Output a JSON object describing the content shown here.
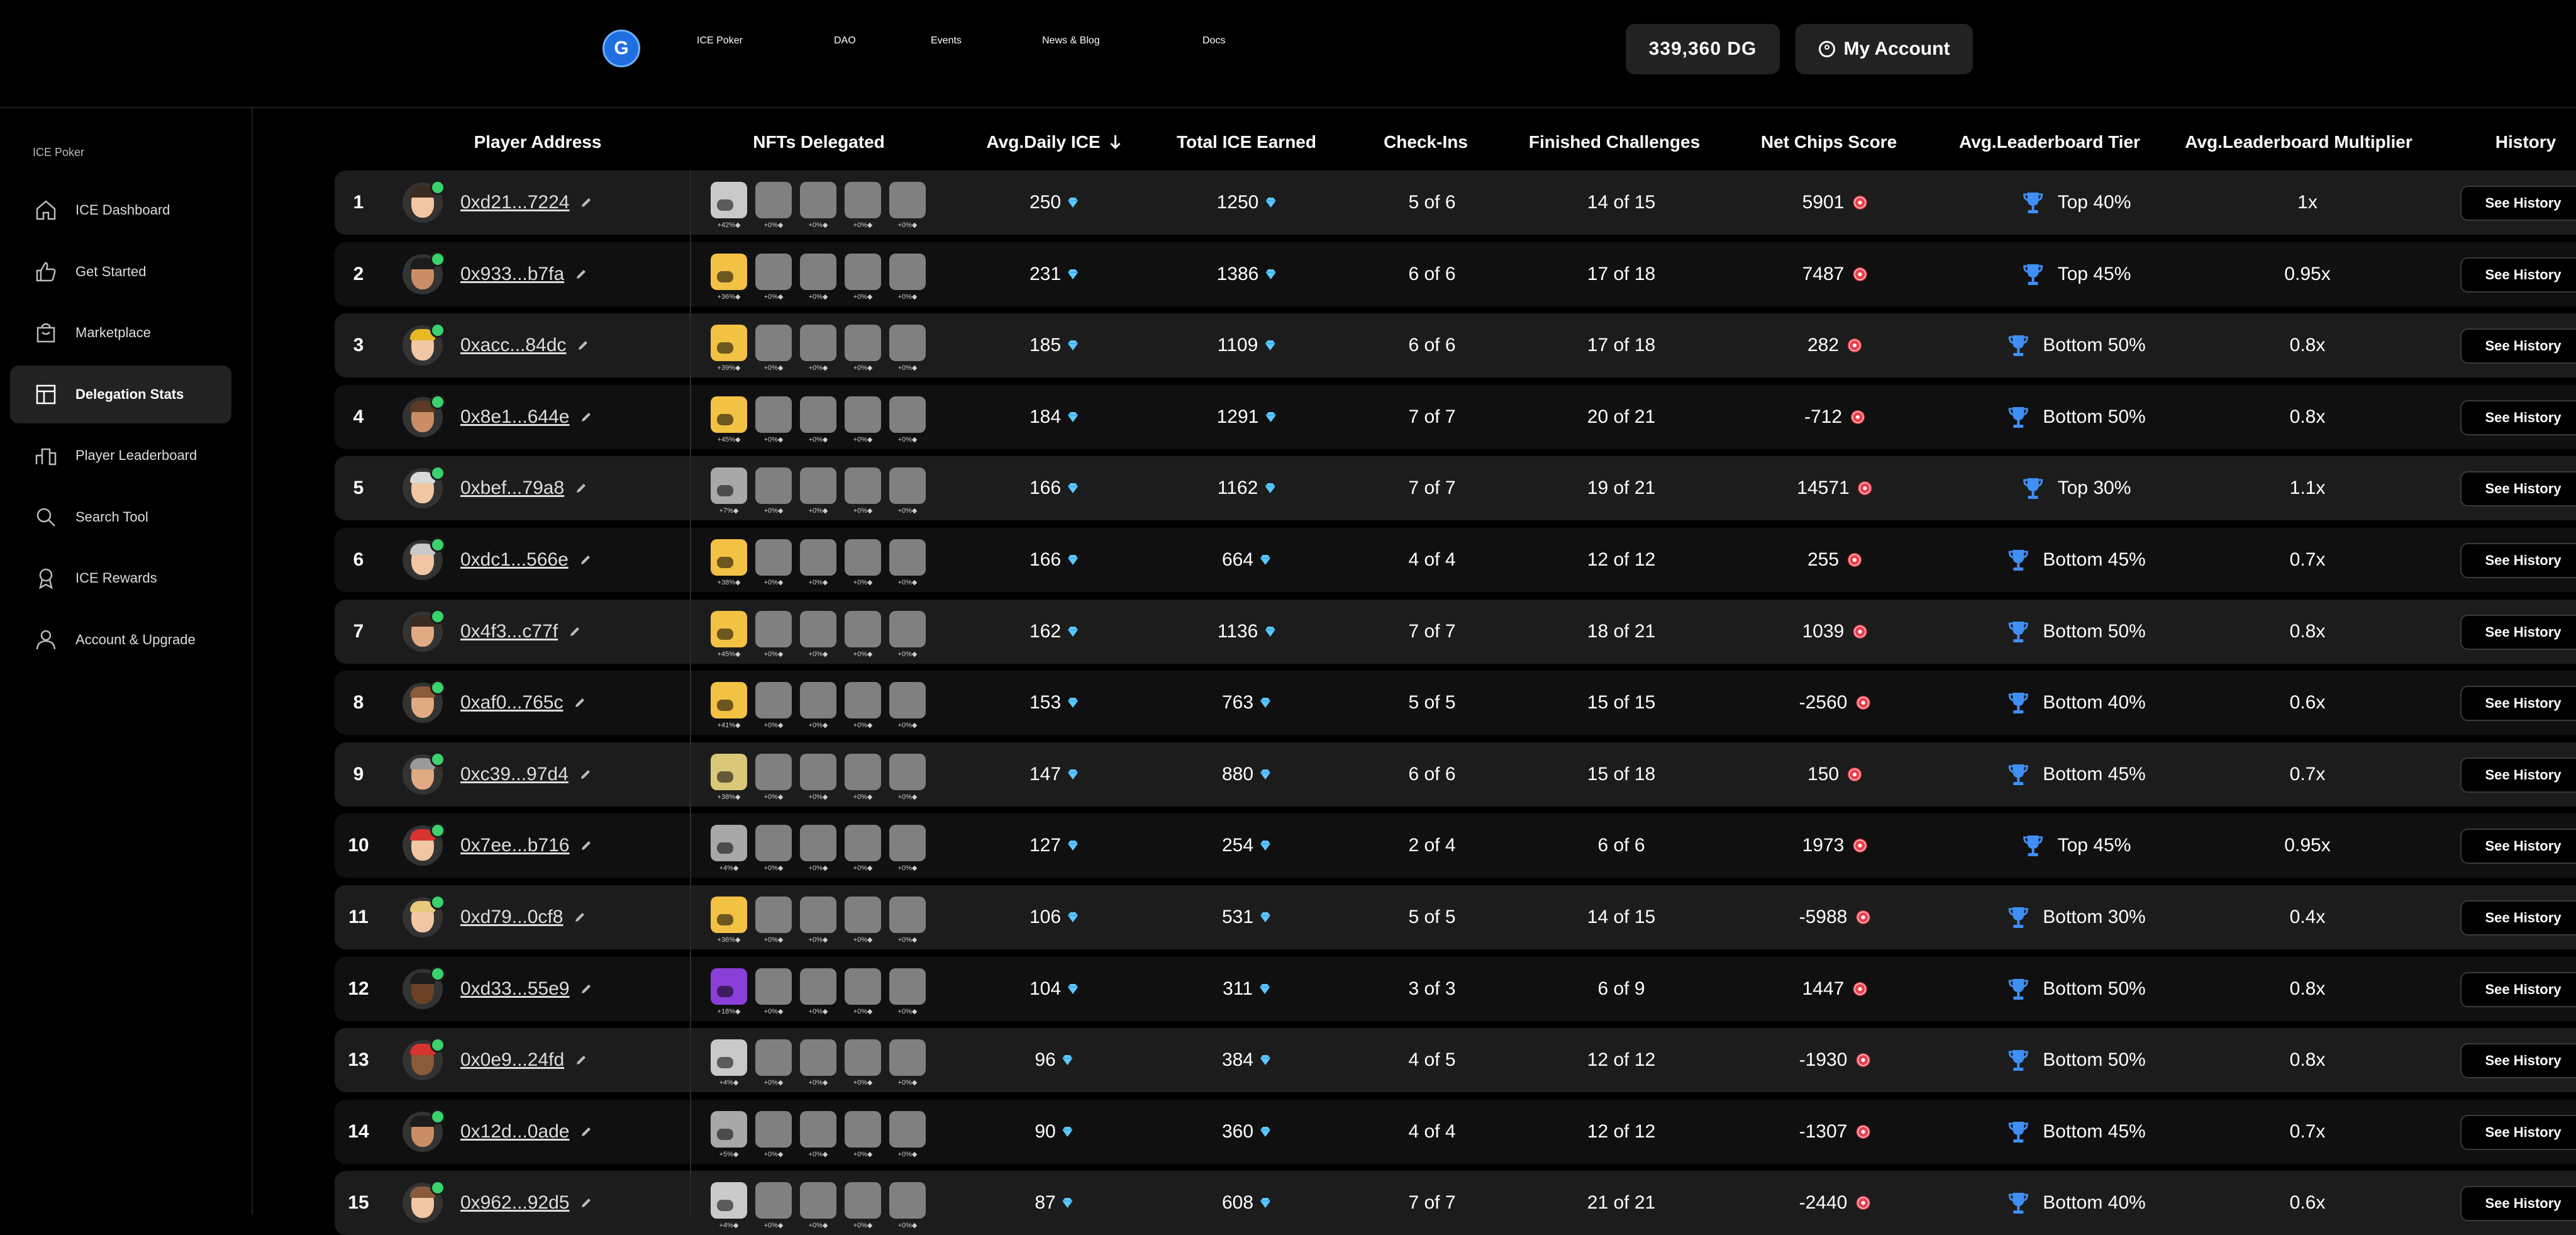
{
  "header": {
    "nav": [
      "ICE Poker",
      "DAO",
      "Events",
      "News & Blog",
      "Docs"
    ],
    "balance": "339,360 DG",
    "account_label": "My Account"
  },
  "sidebar": {
    "title": "ICE Poker",
    "items": [
      {
        "label": "ICE Dashboard",
        "icon": "home-icon"
      },
      {
        "label": "Get Started",
        "icon": "thumbs-up-icon"
      },
      {
        "label": "Marketplace",
        "icon": "shopping-bag-icon"
      },
      {
        "label": "Delegation Stats",
        "icon": "table-icon",
        "active": true
      },
      {
        "label": "Player Leaderboard",
        "icon": "leaderboard-icon"
      },
      {
        "label": "Search Tool",
        "icon": "search-icon"
      },
      {
        "label": "ICE Rewards",
        "icon": "award-icon"
      },
      {
        "label": "Account & Upgrade",
        "icon": "user-icon"
      }
    ]
  },
  "table": {
    "headers": {
      "player": "Player Address",
      "nfts": "NFTs Delegated",
      "avg_ice": "Avg.Daily ICE",
      "total_ice": "Total ICE Earned",
      "checkins": "Check-Ins",
      "challenges": "Finished Challenges",
      "chips": "Net Chips Score",
      "tier": "Avg.Leaderboard Tier",
      "multiplier": "Avg.Leaderboard Multiplier",
      "history": "History"
    },
    "history_label": "See History",
    "empty_nft_pct": "+0%",
    "colors": {
      "gem": "#5cc8ff",
      "chip": "#e8414f",
      "trophy": "#3f8ff5",
      "online": "#3bd16f"
    },
    "rows": [
      {
        "rank": "1",
        "address": "0xd21...7224",
        "nft_pct": "+42%",
        "nft_color": "#c9c9c9",
        "avg_ice": "250",
        "total_ice": "1250",
        "checkins": "5 of 6",
        "challenges": "14 of 15",
        "chips": "5901",
        "tier": "Top 40%",
        "multiplier": "1x",
        "skin": "#f1c7a3",
        "hair": "#3b2a1f"
      },
      {
        "rank": "2",
        "address": "0x933...b7fa",
        "nft_pct": "+36%",
        "nft_color": "#f3c244",
        "avg_ice": "231",
        "total_ice": "1386",
        "checkins": "6 of 6",
        "challenges": "17 of 18",
        "chips": "7487",
        "tier": "Top 45%",
        "multiplier": "0.95x",
        "skin": "#c98e66",
        "hair": "#1c1c1c"
      },
      {
        "rank": "3",
        "address": "0xacc...84dc",
        "nft_pct": "+39%",
        "nft_color": "#f3c244",
        "avg_ice": "185",
        "total_ice": "1109",
        "checkins": "6 of 6",
        "challenges": "17 of 18",
        "chips": "282",
        "tier": "Bottom 50%",
        "multiplier": "0.8x",
        "skin": "#f1c7a3",
        "hair": "#e8b923"
      },
      {
        "rank": "4",
        "address": "0x8e1...644e",
        "nft_pct": "+45%",
        "nft_color": "#f3c244",
        "avg_ice": "184",
        "total_ice": "1291",
        "checkins": "7 of 7",
        "challenges": "20 of 21",
        "chips": "-712",
        "tier": "Bottom 50%",
        "multiplier": "0.8x",
        "skin": "#c98e66",
        "hair": "#5a3a22"
      },
      {
        "rank": "5",
        "address": "0xbef...79a8",
        "nft_pct": "+7%",
        "nft_color": "#a8a8a8",
        "avg_ice": "166",
        "total_ice": "1162",
        "checkins": "7 of 7",
        "challenges": "19 of 21",
        "chips": "14571",
        "tier": "Top 30%",
        "multiplier": "1.1x",
        "skin": "#f1c7a3",
        "hair": "#d9d9d9"
      },
      {
        "rank": "6",
        "address": "0xdc1...566e",
        "nft_pct": "+38%",
        "nft_color": "#f3c244",
        "avg_ice": "166",
        "total_ice": "664",
        "checkins": "4 of 4",
        "challenges": "12 of 12",
        "chips": "255",
        "tier": "Bottom 45%",
        "multiplier": "0.7x",
        "skin": "#f1c7a3",
        "hair": "#c9c9c9"
      },
      {
        "rank": "7",
        "address": "0x4f3...c77f",
        "nft_pct": "+45%",
        "nft_color": "#f3c244",
        "avg_ice": "162",
        "total_ice": "1136",
        "checkins": "7 of 7",
        "challenges": "18 of 21",
        "chips": "1039",
        "tier": "Bottom 50%",
        "multiplier": "0.8x",
        "skin": "#e0aa82",
        "hair": "#3b2a1f"
      },
      {
        "rank": "8",
        "address": "0xaf0...765c",
        "nft_pct": "+41%",
        "nft_color": "#f3c244",
        "avg_ice": "153",
        "total_ice": "763",
        "checkins": "5 of 5",
        "challenges": "15 of 15",
        "chips": "-2560",
        "tier": "Bottom 40%",
        "multiplier": "0.6x",
        "skin": "#e0aa82",
        "hair": "#8a5a3a"
      },
      {
        "rank": "9",
        "address": "0xc39...97d4",
        "nft_pct": "+38%",
        "nft_color": "#d9c878",
        "avg_ice": "147",
        "total_ice": "880",
        "checkins": "6 of 6",
        "challenges": "15 of 18",
        "chips": "150",
        "tier": "Bottom 45%",
        "multiplier": "0.7x",
        "skin": "#e0aa82",
        "hair": "#9a9a9a"
      },
      {
        "rank": "10",
        "address": "0x7ee...b716",
        "nft_pct": "+4%",
        "nft_color": "#a8a8a8",
        "avg_ice": "127",
        "total_ice": "254",
        "checkins": "2 of 4",
        "challenges": "6 of 6",
        "chips": "1973",
        "tier": "Top 45%",
        "multiplier": "0.95x",
        "skin": "#f1c7a3",
        "hair": "#d8332f"
      },
      {
        "rank": "11",
        "address": "0xd79...0cf8",
        "nft_pct": "+36%",
        "nft_color": "#f3c244",
        "avg_ice": "106",
        "total_ice": "531",
        "checkins": "5 of 5",
        "challenges": "14 of 15",
        "chips": "-5988",
        "tier": "Bottom 30%",
        "multiplier": "0.4x",
        "skin": "#f1c7a3",
        "hair": "#e8c87a"
      },
      {
        "rank": "12",
        "address": "0xd33...55e9",
        "nft_pct": "+18%",
        "nft_color": "#8a3fd8",
        "avg_ice": "104",
        "total_ice": "311",
        "checkins": "3 of 3",
        "challenges": "6 of 9",
        "chips": "1447",
        "tier": "Bottom 50%",
        "multiplier": "0.8x",
        "skin": "#6b4226",
        "hair": "#1c1c1c"
      },
      {
        "rank": "13",
        "address": "0x0e9...24fd",
        "nft_pct": "+4%",
        "nft_color": "#c9c9c9",
        "avg_ice": "96",
        "total_ice": "384",
        "checkins": "4 of 5",
        "challenges": "12 of 12",
        "chips": "-1930",
        "tier": "Bottom 50%",
        "multiplier": "0.8x",
        "skin": "#8a5a3a",
        "hair": "#d8332f"
      },
      {
        "rank": "14",
        "address": "0x12d...0ade",
        "nft_pct": "+5%",
        "nft_color": "#a8a8a8",
        "avg_ice": "90",
        "total_ice": "360",
        "checkins": "4 of 4",
        "challenges": "12 of 12",
        "chips": "-1307",
        "tier": "Bottom 45%",
        "multiplier": "0.7x",
        "skin": "#c98e66",
        "hair": "#1c1c1c"
      },
      {
        "rank": "15",
        "address": "0x962...92d5",
        "nft_pct": "+4%",
        "nft_color": "#c9c9c9",
        "avg_ice": "87",
        "total_ice": "608",
        "checkins": "7 of 7",
        "challenges": "21 of 21",
        "chips": "-2440",
        "tier": "Bottom 40%",
        "multiplier": "0.6x",
        "skin": "#f1c7a3",
        "hair": "#8a5a3a"
      }
    ]
  }
}
